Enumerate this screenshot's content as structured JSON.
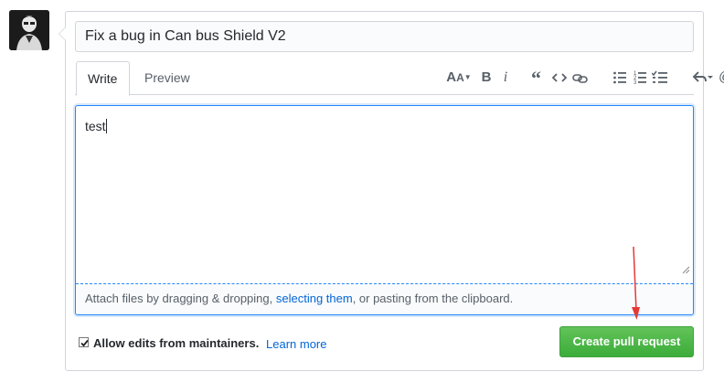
{
  "title_field": {
    "value": "Fix a bug in Can bus Shield V2"
  },
  "tabs": [
    {
      "label": "Write",
      "active": true
    },
    {
      "label": "Preview",
      "active": false
    }
  ],
  "toolbar": {
    "items": [
      {
        "icon": "text-size-icon"
      },
      {
        "icon": "bold-icon",
        "glyph": "B"
      },
      {
        "icon": "italic-icon",
        "glyph": "i"
      },
      {
        "icon": "quote-icon"
      },
      {
        "icon": "code-icon"
      },
      {
        "icon": "link-icon"
      },
      {
        "icon": "unordered-list-icon"
      },
      {
        "icon": "ordered-list-icon"
      },
      {
        "icon": "task-list-icon"
      },
      {
        "icon": "reply-icon"
      },
      {
        "icon": "mention-icon",
        "glyph": "@"
      },
      {
        "icon": "bookmark-icon"
      }
    ]
  },
  "editor": {
    "value": "test",
    "dropzone": {
      "before": "Attach files by dragging & dropping, ",
      "link": "selecting them",
      "after": ", or pasting from the clipboard."
    }
  },
  "footer": {
    "checkbox_checked": true,
    "checkbox_label": "Allow edits from maintainers.",
    "learn_more": "Learn more",
    "submit_label": "Create pull request"
  },
  "colors": {
    "accent": "#0366d6",
    "submit_green": "#3bac3a",
    "focus_border": "#2188ff",
    "arrow_red": "#e53935"
  }
}
